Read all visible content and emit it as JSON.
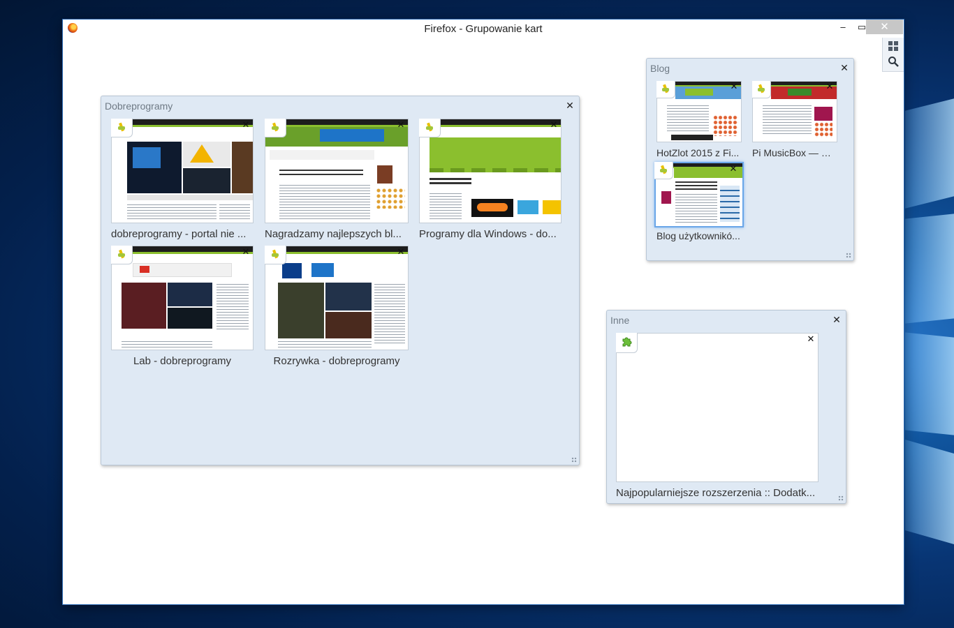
{
  "window": {
    "title": "Firefox - Grupowanie kart",
    "controls": {
      "minimize": "‒",
      "maximize": "▭",
      "close": "✕"
    }
  },
  "toolbar": {
    "icons": [
      "tab-groups-icon",
      "search-icon"
    ]
  },
  "groups": [
    {
      "title": "Dobreprogramy",
      "close": "✕",
      "tabs": [
        {
          "label": "dobreprogramy - portal nie ...",
          "close": "✕",
          "favicon": "dobreprogramy-icon"
        },
        {
          "label": "Nagradzamy najlepszych bl...",
          "close": "✕",
          "favicon": "dobreprogramy-icon"
        },
        {
          "label": "Programy dla Windows - do...",
          "close": "✕",
          "favicon": "dobreprogramy-icon"
        },
        {
          "label": "Lab - dobreprogramy",
          "close": "✕",
          "favicon": "dobreprogramy-icon"
        },
        {
          "label": "Rozrywka - dobreprogramy",
          "close": "✕",
          "favicon": "dobreprogramy-icon"
        }
      ]
    },
    {
      "title": "Blog",
      "close": "✕",
      "tabs": [
        {
          "label": "HotZlot 2015 z Fi...",
          "close": "✕",
          "favicon": "dobreprogramy-icon"
        },
        {
          "label": "Pi MusicBox — m...",
          "close": "✕",
          "favicon": "dobreprogramy-icon"
        },
        {
          "label": "Blog użytkownikó...",
          "close": "✕",
          "favicon": "dobreprogramy-icon",
          "selected": true
        }
      ]
    },
    {
      "title": "Inne",
      "close": "✕",
      "tabs": [
        {
          "label": "Najpopularniejsze rozszerzenia :: Dodatk...",
          "close": "✕",
          "favicon": "puzzle-icon"
        }
      ]
    }
  ],
  "colors": {
    "group_bg": "#dfe9f4",
    "accent_green": "#8bbf2e",
    "selection": "#6aa6e8"
  }
}
